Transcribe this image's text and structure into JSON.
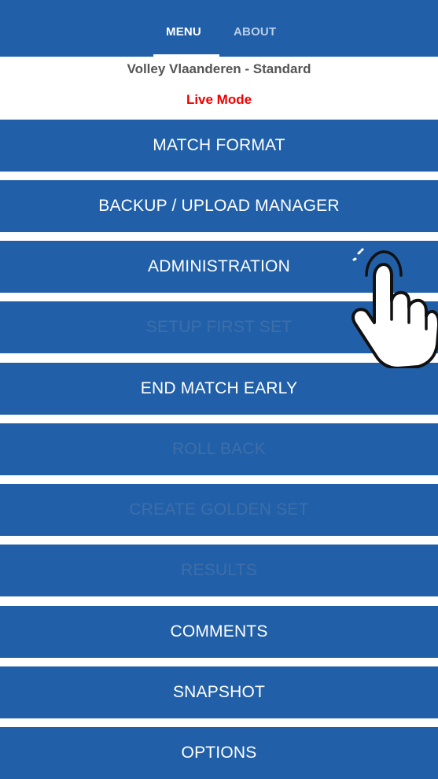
{
  "tabs": [
    {
      "label": "MENU",
      "active": true
    },
    {
      "label": "ABOUT",
      "active": false
    }
  ],
  "profile": "Volley Vlaanderen - Standard",
  "mode": "Live Mode",
  "menu": [
    {
      "label": "MATCH FORMAT",
      "enabled": true
    },
    {
      "label": "BACKUP / UPLOAD MANAGER",
      "enabled": true
    },
    {
      "label": "ADMINISTRATION",
      "enabled": true
    },
    {
      "label": "SETUP FIRST SET",
      "enabled": false
    },
    {
      "label": "END MATCH EARLY",
      "enabled": true
    },
    {
      "label": "ROLL BACK",
      "enabled": false
    },
    {
      "label": "CREATE GOLDEN SET",
      "enabled": false
    },
    {
      "label": "RESULTS",
      "enabled": false
    },
    {
      "label": "COMMENTS",
      "enabled": true
    },
    {
      "label": "SNAPSHOT",
      "enabled": true
    },
    {
      "label": "OPTIONS",
      "enabled": true
    }
  ],
  "colors": {
    "primary": "#2160a8",
    "mode_text": "#ee0000",
    "disabled_text": "#3d6ea8"
  },
  "overlay_icon": "tap-hand-icon"
}
